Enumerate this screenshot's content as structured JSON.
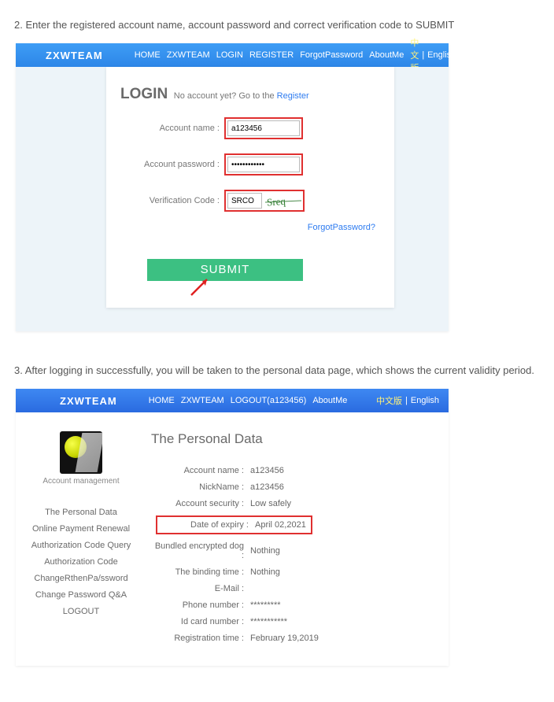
{
  "step2": "2. Enter the registered account name, account password and correct verification code to SUBMIT",
  "step3": "3. After logging in successfully, you will be taken to the personal data page, which shows the current validity period.",
  "brand": "ZXWTEAM",
  "nav1": {
    "home": "HOME",
    "zxw": "ZXWTEAM",
    "login": "LOGIN",
    "register": "REGISTER",
    "forgot": "ForgotPassword",
    "about": "AboutMe"
  },
  "nav2": {
    "home": "HOME",
    "zxw": "ZXWTEAM",
    "logout": "LOGOUT(a123456)",
    "about": "AboutMe"
  },
  "lang_cn": "中文版",
  "lang_sep": "|",
  "lang_en": "English",
  "login": {
    "title": "LOGIN",
    "sub_pre": "No account yet? Go to the ",
    "sub_link": "Register",
    "acct_label": "Account name :",
    "pwd_label": "Account password :",
    "code_label": "Verification Code :",
    "acct_val": "a123456",
    "pwd_val": "••••••••••••",
    "code_val": "SRCO",
    "forgot": "ForgotPassword?",
    "submit": "SUBMIT"
  },
  "side": {
    "caption": "Account management",
    "items": [
      "The Personal Data",
      "Online Payment Renewal",
      "Authorization Code Query",
      "Authorization Code",
      "ChangeRthenPa/ssword",
      "Change Password Q&A",
      "LOGOUT"
    ]
  },
  "pd": {
    "title": "The Personal Data",
    "rows": [
      {
        "l": "Account name :",
        "v": "a123456"
      },
      {
        "l": "NickName :",
        "v": "a123456"
      },
      {
        "l": "Account security :",
        "v": "Low safely"
      },
      {
        "l": "Date of expiry :",
        "v": "April 02,2021",
        "hl": true
      },
      {
        "l": "Bundled encrypted dog :",
        "v": "Nothing"
      },
      {
        "l": "The binding time :",
        "v": "Nothing"
      },
      {
        "l": "E-Mail :",
        "v": ""
      },
      {
        "l": "Phone number :",
        "v": "*********"
      },
      {
        "l": "Id card number :",
        "v": "***********"
      },
      {
        "l": "Registration time :",
        "v": "February 19,2019"
      }
    ]
  }
}
